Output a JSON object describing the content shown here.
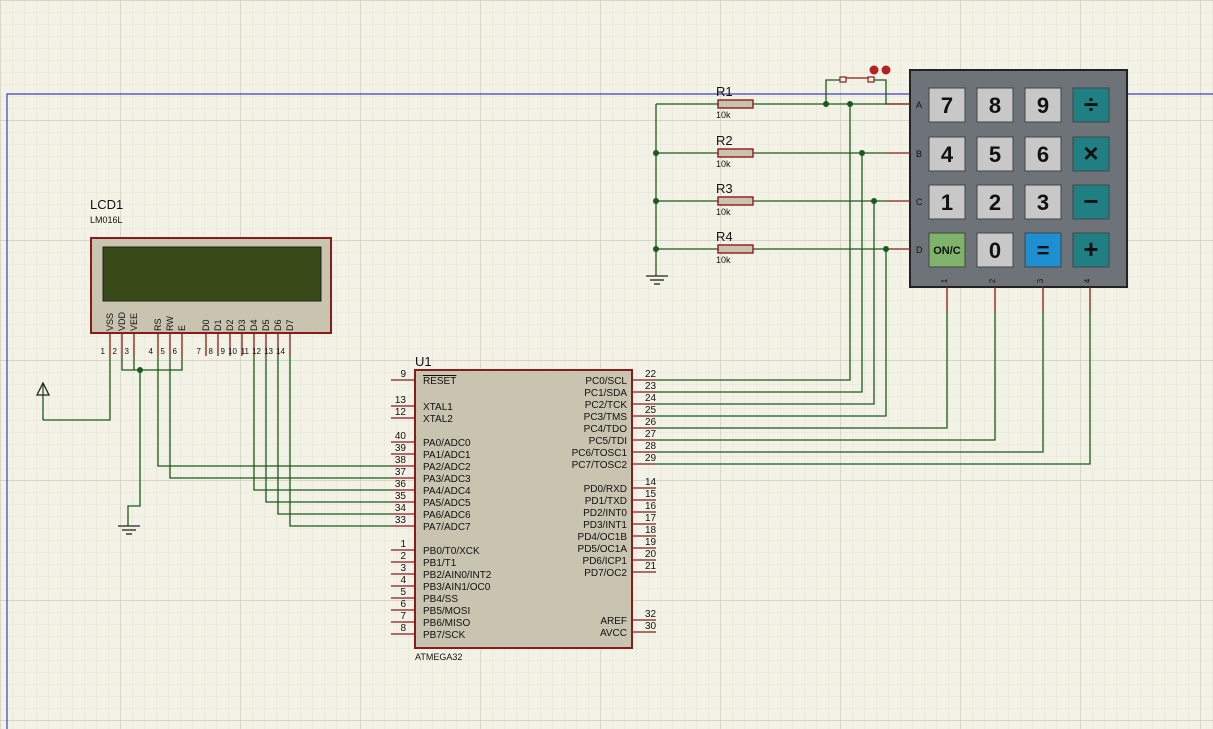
{
  "lcd": {
    "ref": "LCD1",
    "model": "LM016L",
    "pin_names": [
      "VSS",
      "VDD",
      "VEE",
      "RS",
      "RW",
      "E",
      "D0",
      "D1",
      "D2",
      "D3",
      "D4",
      "D5",
      "D6",
      "D7"
    ],
    "pin_numbers": [
      "1",
      "2",
      "3",
      "4",
      "5",
      "6",
      "7",
      "8",
      "9",
      "10",
      "11",
      "12",
      "13",
      "14"
    ]
  },
  "mcu": {
    "ref": "U1",
    "model": "ATMEGA32",
    "left_pins": [
      {
        "num": "9",
        "name": "RESET"
      },
      {
        "num": "13",
        "name": "XTAL1"
      },
      {
        "num": "12",
        "name": "XTAL2"
      },
      {
        "num": "40",
        "name": "PA0/ADC0"
      },
      {
        "num": "39",
        "name": "PA1/ADC1"
      },
      {
        "num": "38",
        "name": "PA2/ADC2"
      },
      {
        "num": "37",
        "name": "PA3/ADC3"
      },
      {
        "num": "36",
        "name": "PA4/ADC4"
      },
      {
        "num": "35",
        "name": "PA5/ADC5"
      },
      {
        "num": "34",
        "name": "PA6/ADC6"
      },
      {
        "num": "33",
        "name": "PA7/ADC7"
      },
      {
        "num": "1",
        "name": "PB0/T0/XCK"
      },
      {
        "num": "2",
        "name": "PB1/T1"
      },
      {
        "num": "3",
        "name": "PB2/AIN0/INT2"
      },
      {
        "num": "4",
        "name": "PB3/AIN1/OC0"
      },
      {
        "num": "5",
        "name": "PB4/SS"
      },
      {
        "num": "6",
        "name": "PB5/MOSI"
      },
      {
        "num": "7",
        "name": "PB6/MISO"
      },
      {
        "num": "8",
        "name": "PB7/SCK"
      }
    ],
    "right_pins": [
      {
        "num": "22",
        "name": "PC0/SCL"
      },
      {
        "num": "23",
        "name": "PC1/SDA"
      },
      {
        "num": "24",
        "name": "PC2/TCK"
      },
      {
        "num": "25",
        "name": "PC3/TMS"
      },
      {
        "num": "26",
        "name": "PC4/TDO"
      },
      {
        "num": "27",
        "name": "PC5/TDI"
      },
      {
        "num": "28",
        "name": "PC6/TOSC1"
      },
      {
        "num": "29",
        "name": "PC7/TOSC2"
      },
      {
        "num": "14",
        "name": "PD0/RXD"
      },
      {
        "num": "15",
        "name": "PD1/TXD"
      },
      {
        "num": "16",
        "name": "PD2/INT0"
      },
      {
        "num": "17",
        "name": "PD3/INT1"
      },
      {
        "num": "18",
        "name": "PD4/OC1B"
      },
      {
        "num": "19",
        "name": "PD5/OC1A"
      },
      {
        "num": "20",
        "name": "PD6/ICP1"
      },
      {
        "num": "21",
        "name": "PD7/OC2"
      },
      {
        "num": "32",
        "name": "AREF"
      },
      {
        "num": "30",
        "name": "AVCC"
      }
    ]
  },
  "resistors": [
    {
      "ref": "R1",
      "value": "10k"
    },
    {
      "ref": "R2",
      "value": "10k"
    },
    {
      "ref": "R3",
      "value": "10k"
    },
    {
      "ref": "R4",
      "value": "10k"
    }
  ],
  "keypad": {
    "row_labels": [
      "A",
      "B",
      "C",
      "D"
    ],
    "col_labels": [
      "1",
      "2",
      "3",
      "4"
    ],
    "keys": [
      [
        "7",
        "8",
        "9",
        "÷"
      ],
      [
        "4",
        "5",
        "6",
        "×"
      ],
      [
        "1",
        "2",
        "3",
        "−"
      ],
      [
        "ON/C",
        "0",
        "=",
        "+"
      ]
    ]
  },
  "colors": {
    "background": "#f3f2e6",
    "grid": "#cfcdb8",
    "wire": "#1c5a1c",
    "component_outline": "#8b1a1a",
    "component_fill": "#c9c4b0",
    "lcd_screen": "#374a18",
    "keypad_body": "#6e737a",
    "key_grey": "#c8c8c8",
    "key_teal": "#1f7f83",
    "key_blue": "#1e8fd0",
    "key_green": "#7fb26a",
    "sheet_border": "#3f3fbf"
  }
}
